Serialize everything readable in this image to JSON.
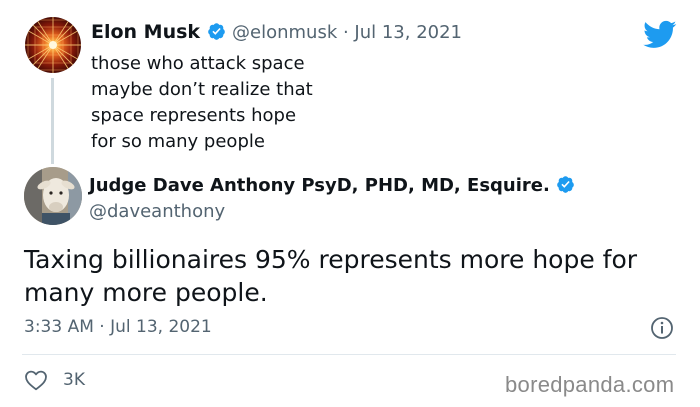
{
  "quoted_tweet": {
    "name": "Elon Musk",
    "handle_date": "@elonmusk · Jul 13, 2021",
    "lines": [
      "those who attack space",
      "maybe don’t realize that",
      "space represents hope",
      "for so many people"
    ]
  },
  "main_tweet": {
    "name": "Judge Dave Anthony PsyD, PHD, MD, Esquire.",
    "handle": "@daveanthony",
    "lines": [
      "Taxing billionaires 95% represents more hope for",
      "many more people."
    ],
    "timestamp": "3:33 AM · Jul 13, 2021",
    "likes": "3K"
  },
  "watermark": "boredpanda.com",
  "icons": {
    "verified": "verified-badge-icon",
    "bird": "twitter-bird-icon",
    "info": "info-icon",
    "like": "heart-icon"
  },
  "colors": {
    "twitter_blue": "#1d9bf0",
    "secondary_text": "#536471"
  }
}
